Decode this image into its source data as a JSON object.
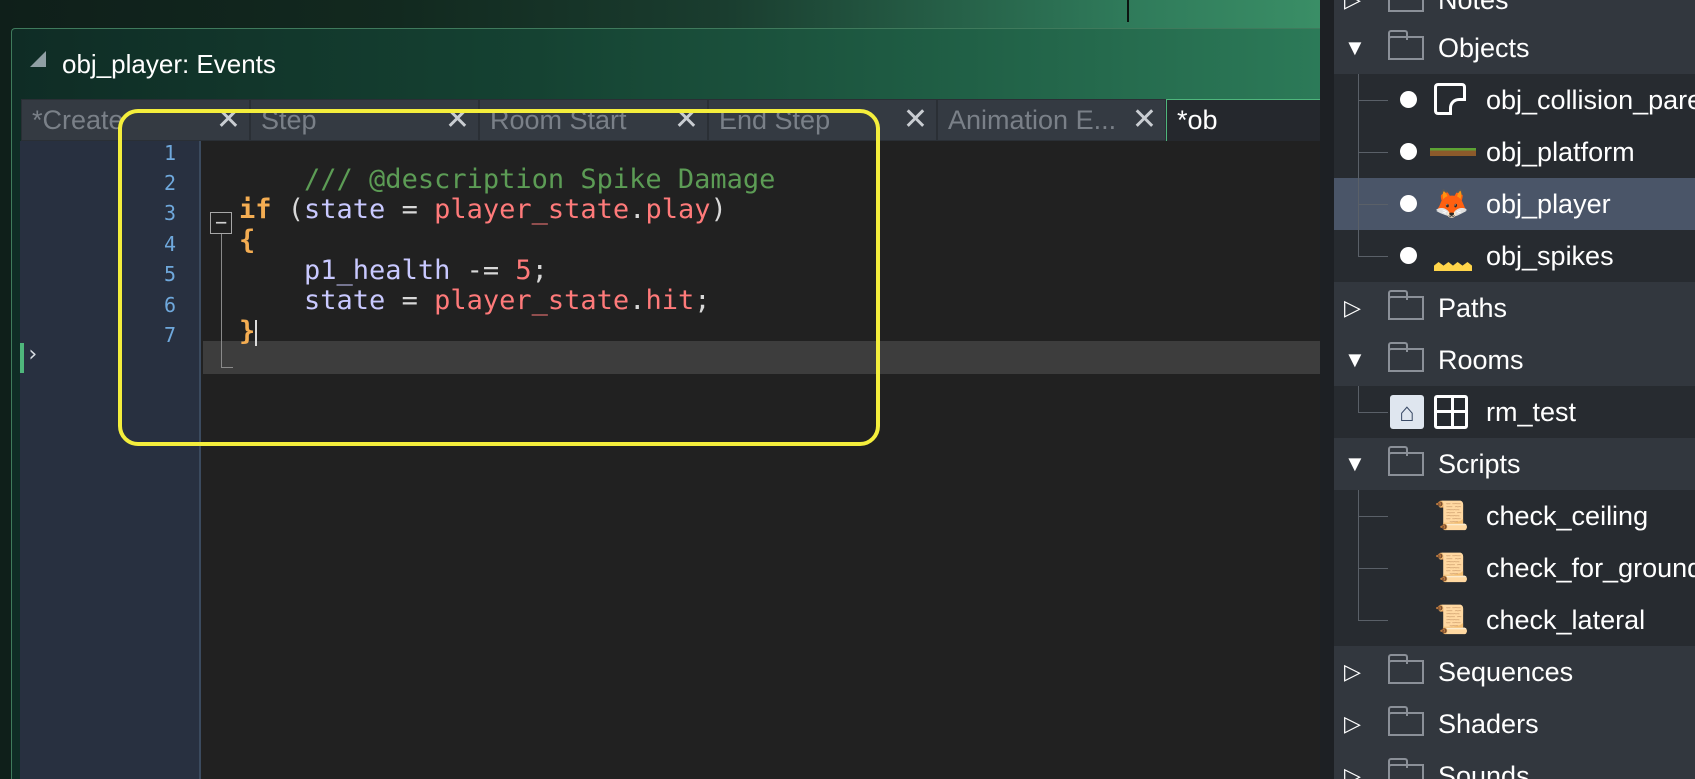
{
  "window": {
    "title": "obj_player: Events"
  },
  "tabs": [
    {
      "label": "*Create",
      "close": "✕"
    },
    {
      "label": "Step",
      "close": "✕"
    },
    {
      "label": "Room Start",
      "close": "✕"
    },
    {
      "label": "End Step",
      "close": "✕"
    },
    {
      "label": "Animation E...",
      "close": "✕"
    },
    {
      "label": "*ob",
      "close": ""
    }
  ],
  "editor": {
    "line_numbers": [
      "1",
      "2",
      "3",
      "4",
      "5",
      "6",
      "7"
    ],
    "fold_symbol": "−",
    "gutter_arrow": "›",
    "code": {
      "l1": "/// @description Spike Damage",
      "l3_kw": "if",
      "l3_open": " (",
      "l3_var": "state",
      "l3_eq": " = ",
      "l3_enum": "player_state",
      "l3_dot": ".",
      "l3_member": "play",
      "l3_close": ")",
      "l4": "{",
      "l5_indent": "    ",
      "l5_var": "p1_health",
      "l5_op": " -= ",
      "l5_num": "5",
      "l5_end": ";",
      "l6_indent": "    ",
      "l6_var": "state",
      "l6_eq": " = ",
      "l6_enum": "player_state",
      "l6_dot": ".",
      "l6_member": "hit",
      "l6_end": ";",
      "l7": "}"
    }
  },
  "asset_browser": {
    "rows": {
      "notes": "Notes",
      "objects": "Objects",
      "obj_collision": "obj_collision_parent",
      "obj_platform": "obj_platform",
      "obj_player": "obj_player",
      "obj_spikes": "obj_spikes",
      "paths": "Paths",
      "rooms": "Rooms",
      "rm_test": "rm_test",
      "scripts": "Scripts",
      "check_ceiling": "check_ceiling",
      "check_for_ground": "check_for_ground",
      "check_lateral": "check_lateral",
      "sequences": "Sequences",
      "shaders": "Shaders",
      "sounds": "Sounds"
    },
    "expand_arrow": "▼",
    "collapse_arrow": "▷",
    "icons": {
      "script": "📜",
      "player": "🦊",
      "home": "⌂"
    }
  },
  "colors": {
    "highlight_box": "#f4ee3c",
    "active_tab_border": "#4fb67c",
    "selected_row": "#4a5568"
  }
}
